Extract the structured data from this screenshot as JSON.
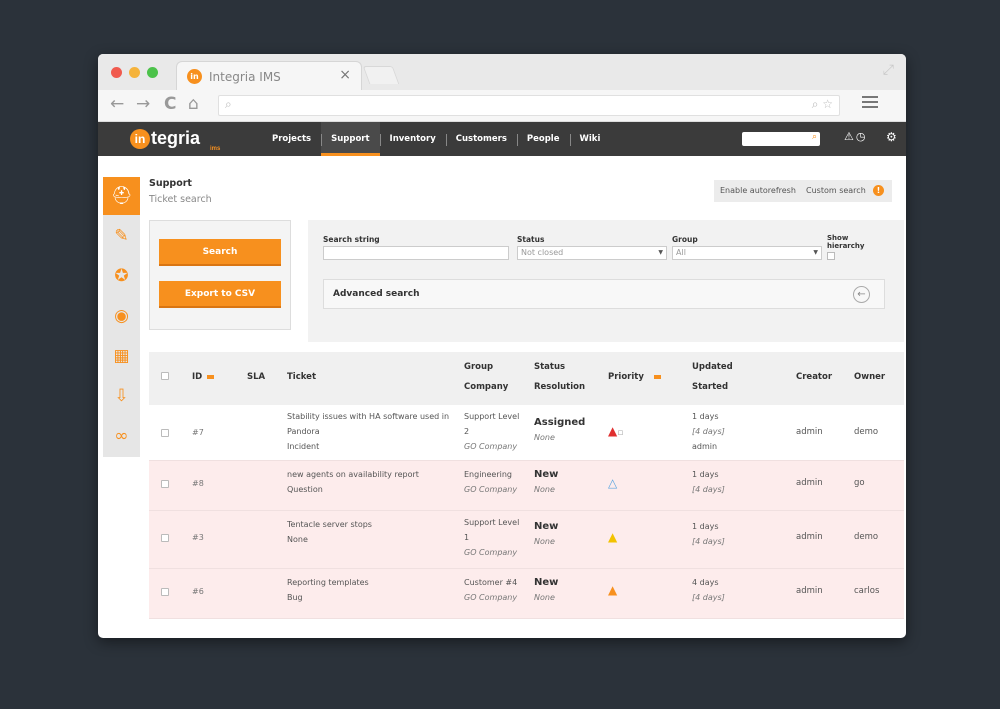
{
  "browser": {
    "tab_title": "Integria IMS",
    "tab_favicon_text": "in",
    "close_glyph": "×",
    "nav": {
      "back": "←",
      "forward": "→",
      "reload": "C",
      "home": "⌂"
    }
  },
  "app": {
    "logo_prefix": "in",
    "logo_text": "tegria",
    "logo_sub": "ims",
    "accent": "#f7901e",
    "nav": [
      {
        "label": "Projects",
        "active": false
      },
      {
        "label": "Support",
        "active": true
      },
      {
        "label": "Inventory",
        "active": false
      },
      {
        "label": "Customers",
        "active": false
      },
      {
        "label": "People",
        "active": false
      },
      {
        "label": "Wiki",
        "active": false
      }
    ]
  },
  "sidebar": {
    "icons": [
      "support-icon",
      "ticket-icon",
      "badge-icon",
      "chat-icon",
      "calendar-icon",
      "download-icon",
      "link-icon"
    ]
  },
  "breadcrumb": {
    "section": "Support",
    "page": "Ticket search"
  },
  "right_links": {
    "autorefresh": "Enable autorefresh",
    "custom_search": "Custom search",
    "info": "!"
  },
  "buttons": {
    "search": "Search",
    "export": "Export to CSV"
  },
  "filters": {
    "search_string_label": "Search string",
    "search_string_value": "",
    "status_label": "Status",
    "status_value": "Not closed",
    "group_label": "Group",
    "group_value": "All",
    "hierarchy_label_1": "Show",
    "hierarchy_label_2": "hierarchy",
    "advanced": "Advanced search"
  },
  "table": {
    "headers": {
      "id": "ID",
      "sla": "SLA",
      "ticket": "Ticket",
      "group": "Group",
      "company": "Company",
      "status": "Status",
      "resolution": "Resolution",
      "priority": "Priority",
      "updated": "Updated",
      "started": "Started",
      "creator": "Creator",
      "owner": "Owner"
    },
    "rows": [
      {
        "id": "#7",
        "title1": "Stability issues with HA software used in",
        "title2": "Pandora",
        "type": "Incident",
        "group1": "Support Level",
        "group2": "2",
        "company": "GO Company",
        "status": "Assigned",
        "resolution": "None",
        "updated": "1 days",
        "started": "[4 days]",
        "extra": "admin",
        "creator": "admin",
        "owner": "demo",
        "priority_color": "#e03030"
      },
      {
        "id": "#8",
        "title1": "new agents on availability report",
        "title2": "Question",
        "type": "",
        "group1": "Engineering",
        "group2": "",
        "company": "GO Company",
        "status": "New",
        "resolution": "None",
        "updated": "1 days",
        "started": "[4 days]",
        "extra": "",
        "creator": "admin",
        "owner": "go",
        "priority_color": "#5aa5e0"
      },
      {
        "id": "#3",
        "title1": "Tentacle server stops",
        "title2": "None",
        "type": "",
        "group1": "Support Level",
        "group2": "1",
        "company": "GO Company",
        "status": "New",
        "resolution": "None",
        "updated": "1 days",
        "started": "[4 days]",
        "extra": "",
        "creator": "admin",
        "owner": "demo",
        "priority_color": "#f2c200"
      },
      {
        "id": "#6",
        "title1": "Reporting templates",
        "title2": "Bug",
        "type": "",
        "group1": "Customer #4",
        "group2": "",
        "company": "GO Company",
        "status": "New",
        "resolution": "None",
        "updated": "4 days",
        "started": "[4 days]",
        "extra": "",
        "creator": "admin",
        "owner": "carlos",
        "priority_color": "#f7901e"
      }
    ]
  }
}
